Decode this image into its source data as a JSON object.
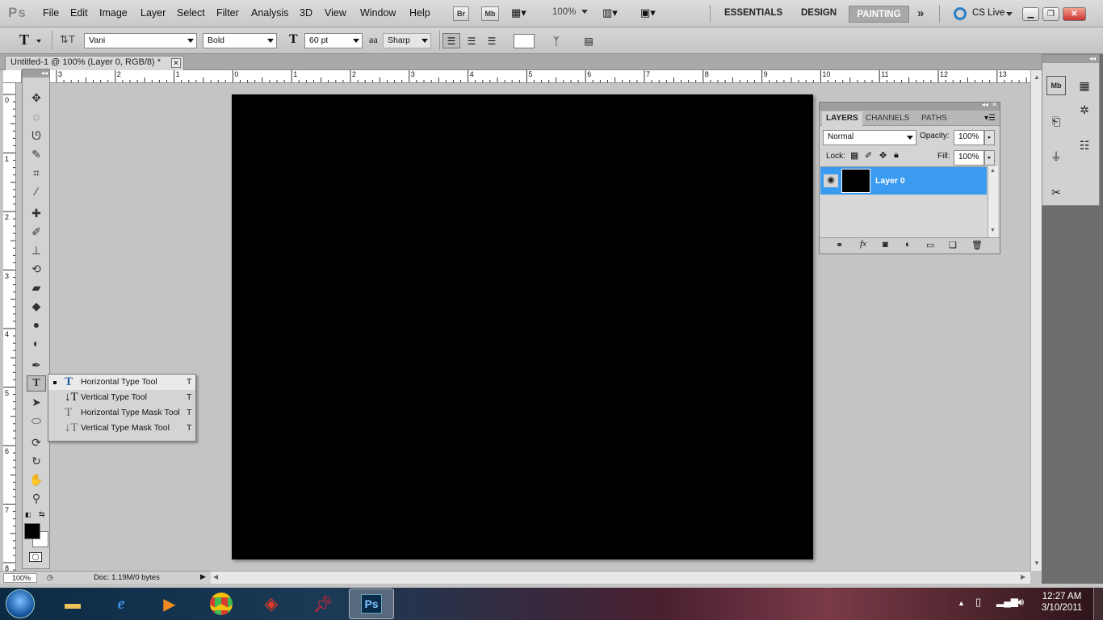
{
  "app": {
    "logo": "Ps"
  },
  "menu": {
    "items": [
      "File",
      "Edit",
      "Image",
      "Layer",
      "Select",
      "Filter",
      "Analysis",
      "3D",
      "View",
      "Window",
      "Help"
    ],
    "bridge_btn": "Br",
    "minibridge_btn": "Mb",
    "zoom": "100%",
    "workspaces": {
      "essentials": "ESSENTIALS",
      "design": "DESIGN",
      "painting": "PAINTING"
    },
    "cs_live": "CS Live"
  },
  "options": {
    "tool_icon": "T",
    "font_family": "Vani",
    "font_style": "Bold",
    "font_size": "60 pt",
    "antialias_icon": "aa",
    "antialias": "Sharp"
  },
  "document": {
    "tab_title": "Untitled-1 @ 100% (Layer 0, RGB/8) *"
  },
  "rulers": {
    "horizontal": [
      "3",
      "2",
      "1",
      "0",
      "1",
      "2",
      "3",
      "4",
      "5",
      "6",
      "7",
      "8",
      "9",
      "10",
      "11",
      "12",
      "13"
    ],
    "vertical": [
      "0",
      "1",
      "2",
      "3",
      "4",
      "5",
      "6",
      "7",
      "8"
    ]
  },
  "flyout": {
    "items": [
      {
        "label": "Horizontal Type Tool",
        "shortcut": "T",
        "icon": "horizontal-type-icon",
        "selected": true
      },
      {
        "label": "Vertical Type Tool",
        "shortcut": "T",
        "icon": "vertical-type-icon",
        "selected": false
      },
      {
        "label": "Horizontal Type Mask Tool",
        "shortcut": "T",
        "icon": "horizontal-type-mask-icon",
        "selected": false
      },
      {
        "label": "Vertical Type Mask Tool",
        "shortcut": "T",
        "icon": "vertical-type-mask-icon",
        "selected": false
      }
    ]
  },
  "layers_panel": {
    "tabs": [
      "LAYERS",
      "CHANNELS",
      "PATHS"
    ],
    "blend_mode": "Normal",
    "opacity_label": "Opacity:",
    "opacity": "100%",
    "lock_label": "Lock:",
    "fill_label": "Fill:",
    "fill": "100%",
    "layers": [
      {
        "name": "Layer 0",
        "visible": true,
        "selected": true
      }
    ]
  },
  "status": {
    "zoom": "100%",
    "doc_size": "Doc: 1.19M/0 bytes"
  },
  "taskbar": {
    "time": "12:27 AM",
    "date": "3/10/2011"
  },
  "colors": {
    "accent": "#3b9bf0",
    "canvas": "#000000",
    "foreground": "#000000",
    "background": "#ffffff"
  }
}
